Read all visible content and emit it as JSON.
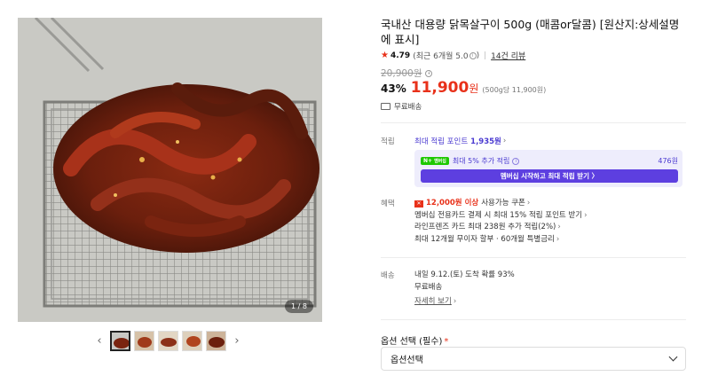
{
  "gallery": {
    "counter": "1 / 8",
    "thumbnails": [
      "thumb-1",
      "thumb-2",
      "thumb-3",
      "thumb-4",
      "thumb-5"
    ],
    "prev_icon": "chevron-left-icon",
    "next_icon": "chevron-right-icon"
  },
  "product": {
    "title": "국내산 대용량 닭목살구이 500g (매콤or달콤) [원산지:상세설명에 표시]",
    "rating": "4.79",
    "rating_note": "(최근 6개월 5.0",
    "rating_note_end": ")",
    "review_link": "14건 리뷰",
    "original_price": "20,900원",
    "discount": "43%",
    "sale_price": "11,900",
    "currency": "원",
    "unit_price": "(500g당 11,900원)",
    "shipping_tag": "무료배송"
  },
  "points": {
    "label": "적립",
    "line_prefix": "최대 적립 포인트",
    "line_value": "1,935원",
    "membership_badge": "N+",
    "membership_badge_sub": "멤버십",
    "membership_text": "최대 5% 추가 적립",
    "membership_amount": "476원",
    "membership_button": "멤버십 시작하고 최대 적립 받기 〉"
  },
  "benefits": {
    "label": "혜택",
    "coupon_amount": "12,000원 이상",
    "coupon_text": "사용가능 쿠폰",
    "items": [
      "멤버십 전용카드 결제 시 최대 15% 적립 포인트 받기",
      "라인프렌즈 카드 최대 238원 추가 적립(2%)",
      "최대 12개월 무이자 할부 · 60개월 특별금리"
    ]
  },
  "delivery": {
    "label": "배송",
    "eta": "내일 9.12.(토) 도착 확률 93%",
    "fee": "무료배송",
    "detail_link": "자세히 보기"
  },
  "options": {
    "label": "옵션 선택 (필수)",
    "required_mark": "*",
    "select_value": "옵션선택"
  },
  "colors": {
    "accent_red": "#e8311a",
    "accent_purple": "#5d3fe0",
    "naver_green": "#1ec800"
  }
}
